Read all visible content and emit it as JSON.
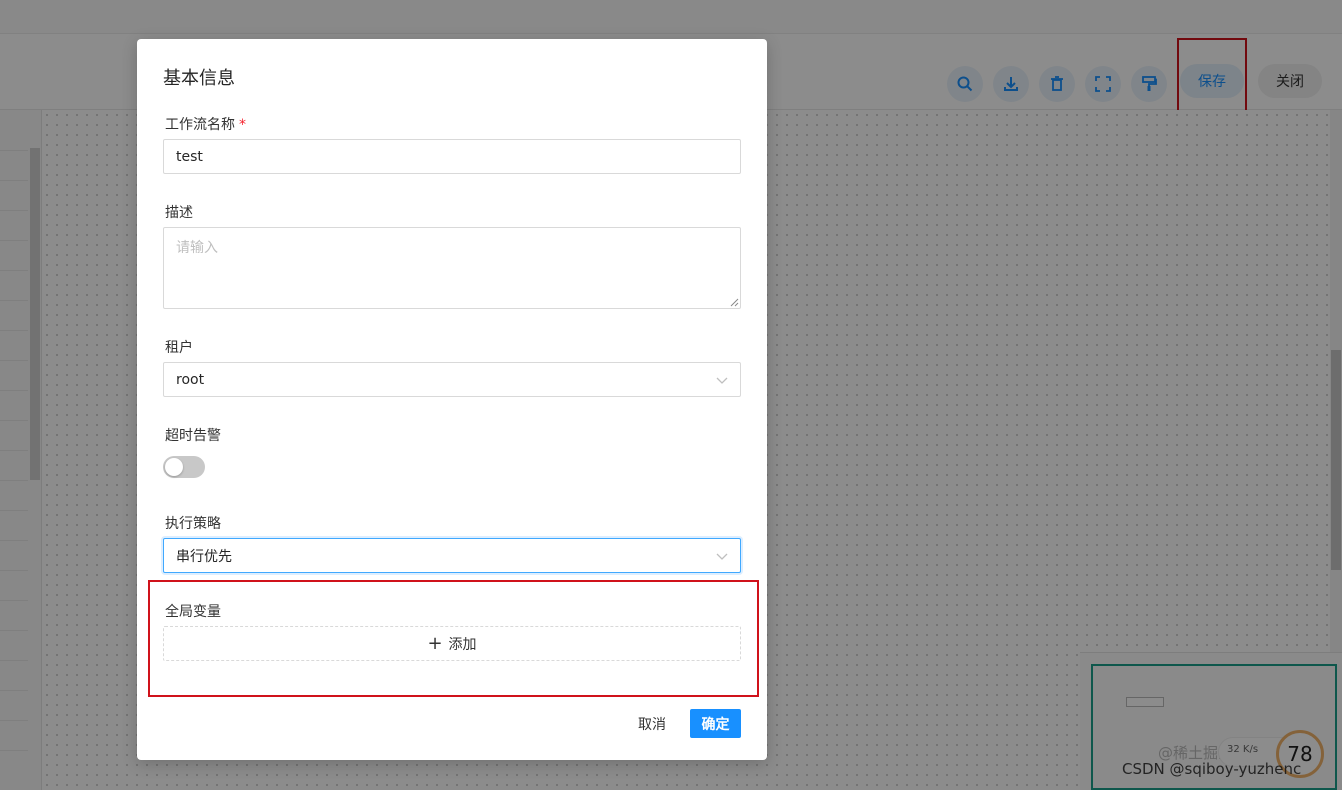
{
  "toolbar": {
    "save_label": "保存",
    "close_label": "关闭",
    "icons": [
      "search-icon",
      "download-icon",
      "delete-icon",
      "fit-view-icon",
      "format-brush-icon"
    ]
  },
  "dialog": {
    "title": "基本信息",
    "name_label": "工作流名称",
    "name_required": "*",
    "name_value": "test",
    "desc_label": "描述",
    "desc_placeholder": "请输入",
    "tenant_label": "租户",
    "tenant_value": "root",
    "timeout_label": "超时告警",
    "timeout_enabled": false,
    "strategy_label": "执行策略",
    "strategy_value": "串行优先",
    "vars_label": "全局变量",
    "add_label": "添加",
    "cancel_label": "取消",
    "ok_label": "确定"
  },
  "overlay": {
    "speed": "32 K/s",
    "score": "78",
    "watermark": "CSDN @sqiboy-yuzhenc",
    "watermark_back": "@稀土掘金技术社区"
  },
  "colors": {
    "primary": "#1890ff",
    "highlight": "#d0121b",
    "required": "#f5222d"
  }
}
